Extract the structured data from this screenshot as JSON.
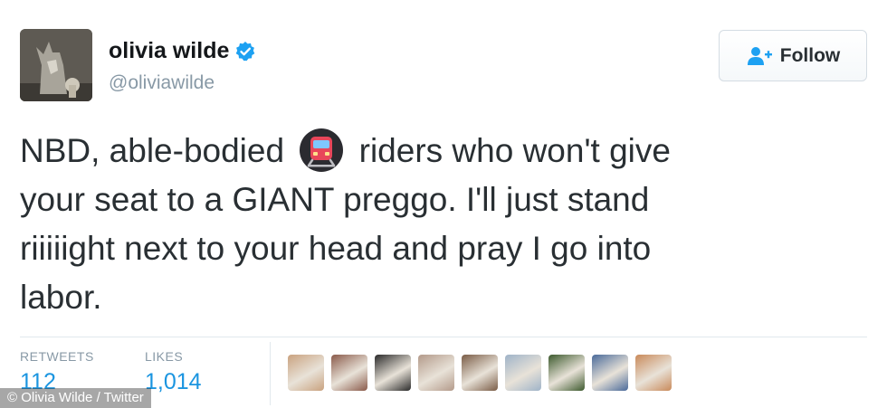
{
  "user": {
    "display_name": "olivia wilde",
    "handle": "@oliviawilde",
    "avatar_icon": "wolf-photo",
    "verified_icon": "verified-badge-icon",
    "verified_color": "#1da1f2"
  },
  "follow_button": {
    "label": "Follow",
    "icon": "add-user-icon",
    "icon_color": "#1da1f2"
  },
  "tweet": {
    "text_lines": [
      "NBD, able-bodied ",
      " riders who won't give",
      "your seat to a GIANT preggo. I'll just stand",
      "riiiiight next to your head and pray I go into",
      "labor."
    ],
    "emoji": "metro-train-icon"
  },
  "stats": {
    "retweets_label": "RETWEETS",
    "retweets_value": "112",
    "likes_label": "LIKES",
    "likes_value": "1,014"
  },
  "likers": [
    {
      "name": "liker-avatar",
      "color": "#c9a27f"
    },
    {
      "name": "liker-avatar",
      "color": "#8a5a4a"
    },
    {
      "name": "liker-avatar",
      "color": "#2a2a2a"
    },
    {
      "name": "liker-avatar",
      "color": "#b39a8a"
    },
    {
      "name": "liker-avatar",
      "color": "#7a5c46"
    },
    {
      "name": "liker-avatar",
      "color": "#9fb3c8"
    },
    {
      "name": "liker-avatar",
      "color": "#3d5a2e"
    },
    {
      "name": "liker-avatar",
      "color": "#4a6a9a"
    },
    {
      "name": "liker-avatar",
      "color": "#c98a5a"
    }
  ],
  "watermark": "© Olivia Wilde / Twitter",
  "colors": {
    "link_blue": "#1b95e0",
    "muted_gray": "#8899a6",
    "text_dark": "#292f33"
  }
}
